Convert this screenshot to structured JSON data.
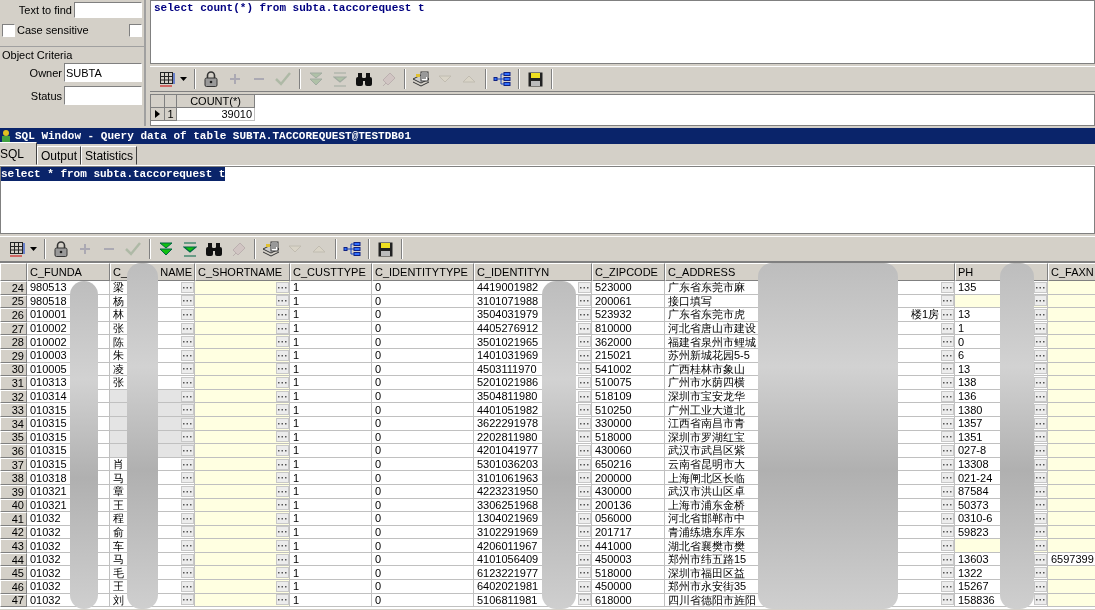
{
  "find_panel": {
    "text_to_find": {
      "label": "Text to find"
    },
    "case_sensitive": {
      "label": "Case sensitive",
      "checked": false
    },
    "extra_option": {
      "checked": false
    },
    "object_criteria": {
      "title": "Object Criteria",
      "fields": [
        {
          "label": "Owner",
          "value": "SUBTA"
        },
        {
          "label": "Status"
        }
      ]
    }
  },
  "count_editor": {
    "sql": "select count(*) from subta.taccorequest t",
    "selected": false
  },
  "count_toolbar": {
    "groups": [
      [
        {
          "kind": "grid",
          "disabled": false
        }
      ],
      [
        {
          "kind": "lock",
          "disabled": false
        },
        {
          "kind": "add",
          "disabled": true
        },
        {
          "kind": "remove",
          "disabled": true
        },
        {
          "kind": "post",
          "disabled": true
        }
      ],
      [
        {
          "kind": "fetch-next",
          "disabled": true
        },
        {
          "kind": "fetch-last",
          "disabled": true
        },
        {
          "kind": "find",
          "disabled": false
        },
        {
          "kind": "clear",
          "disabled": true
        }
      ],
      [
        {
          "kind": "export",
          "disabled": false
        },
        {
          "kind": "sort-down",
          "disabled": true
        },
        {
          "kind": "sort-up",
          "disabled": true
        }
      ],
      [
        {
          "kind": "tree",
          "disabled": false
        }
      ],
      [
        {
          "kind": "save",
          "disabled": false
        }
      ]
    ]
  },
  "count_grid": {
    "columns": [
      "COUNT(*)"
    ],
    "rows": [
      {
        "number": "1",
        "current": true,
        "cells": [
          "39010"
        ]
      }
    ]
  },
  "sql_window": {
    "title": "SQL Window - Query data of table SUBTA.TACCOREQUEST@TESTDB01",
    "tabs": [
      {
        "label": "SQL",
        "selected": true
      },
      {
        "label": "Output",
        "selected": false
      },
      {
        "label": "Statistics",
        "selected": false
      }
    ],
    "editor": {
      "sql": "select * from subta.taccorequest t",
      "selected": true
    },
    "toolbar": {
      "groups": [
        [
          {
            "kind": "grid",
            "disabled": false
          }
        ],
        [
          {
            "kind": "lock",
            "disabled": false
          },
          {
            "kind": "add",
            "disabled": true
          },
          {
            "kind": "remove",
            "disabled": true
          },
          {
            "kind": "post",
            "disabled": true
          }
        ],
        [
          {
            "kind": "fetch-next",
            "disabled": false
          },
          {
            "kind": "fetch-last",
            "disabled": false
          },
          {
            "kind": "find",
            "disabled": false
          },
          {
            "kind": "clear",
            "disabled": true
          }
        ],
        [
          {
            "kind": "export",
            "disabled": false
          },
          {
            "kind": "sort-down",
            "disabled": true
          },
          {
            "kind": "sort-up",
            "disabled": true
          }
        ],
        [
          {
            "kind": "tree",
            "disabled": false
          }
        ],
        [
          {
            "kind": "save",
            "disabled": false
          }
        ]
      ]
    },
    "grid": {
      "columns": [
        {
          "label": "C_FUNDA",
          "kind": "text"
        },
        {
          "label": "C_",
          "label_tail": "NAME",
          "kind": "lookup"
        },
        {
          "label": "C_SHORTNAME",
          "kind": "lookup"
        },
        {
          "label": "C_CUSTTYPE",
          "kind": "text"
        },
        {
          "label": "C_IDENTITYTYPE",
          "kind": "text"
        },
        {
          "label": "C_IDENTITYN",
          "kind": "lookup"
        },
        {
          "label": "C_ZIPCODE",
          "kind": "text"
        },
        {
          "label": "C_ADDRESS",
          "kind": "lookup"
        },
        {
          "label": "PH",
          "kind": "lookup"
        },
        {
          "label": "C_FAXN",
          "kind": "lookup"
        }
      ],
      "rows": [
        {
          "number": "24",
          "cells": [
            "980513",
            "梁",
            null,
            "1",
            "0",
            "4419001982",
            "523000",
            "广东省东莞市麻",
            "135",
            null
          ]
        },
        {
          "number": "25",
          "cells": [
            "980518",
            "杨",
            null,
            "1",
            "0",
            "3101071988",
            "200061",
            "接口填写",
            null,
            null
          ]
        },
        {
          "number": "26",
          "cells": [
            "010001",
            "林",
            null,
            "1",
            "0",
            "3504031979",
            "523932",
            {
              "text": "广东省东莞市虎",
              "tail": "楼1房"
            },
            "13",
            null
          ]
        },
        {
          "number": "27",
          "cells": [
            "010002",
            "张",
            null,
            "1",
            "0",
            "4405276912",
            "810000",
            "河北省唐山市建设",
            "1",
            null
          ]
        },
        {
          "number": "28",
          "cells": [
            "010002",
            "陈",
            null,
            "1",
            "0",
            "3501021965",
            "362000",
            "福建省泉州市鲤城",
            "0",
            null
          ]
        },
        {
          "number": "29",
          "cells": [
            "010003",
            "朱",
            null,
            "1",
            "0",
            "1401031969",
            "215021",
            "苏州新城花园5-5",
            "6",
            null
          ]
        },
        {
          "number": "30",
          "cells": [
            "010005",
            "凌",
            null,
            "1",
            "0",
            "4503111970",
            "541002",
            "广西桂林市象山",
            "13",
            null
          ]
        },
        {
          "number": "31",
          "cells": [
            "010313",
            "张",
            null,
            "1",
            "0",
            "5201021986",
            "510075",
            "广州市水荫四横",
            "138",
            null
          ]
        },
        {
          "number": "32",
          "cells": [
            "010314",
            {
              "redacted": true
            },
            null,
            "1",
            "0",
            "3504811980",
            "518109",
            "深圳市宝安龙华",
            "136",
            null
          ]
        },
        {
          "number": "33",
          "cells": [
            "010315",
            {
              "redacted": true
            },
            null,
            "1",
            "0",
            "4401051982",
            "510250",
            "广州工业大道北",
            "1380",
            null
          ]
        },
        {
          "number": "34",
          "cells": [
            "010315",
            {
              "redacted": true
            },
            null,
            "1",
            "0",
            "3622291978",
            "330000",
            "江西省南昌市青",
            "1357",
            null
          ]
        },
        {
          "number": "35",
          "cells": [
            "010315",
            {
              "redacted": true
            },
            null,
            "1",
            "0",
            "2202811980",
            "518000",
            "深圳市罗湖红宝",
            "1351",
            null
          ]
        },
        {
          "number": "36",
          "cells": [
            "010315",
            {
              "redacted": true
            },
            null,
            "1",
            "0",
            "4201041977",
            "430060",
            "武汉市武昌区紫",
            "027-8",
            null
          ]
        },
        {
          "number": "37",
          "cells": [
            "010315",
            "肖",
            null,
            "1",
            "0",
            "5301036203",
            "650216",
            "云南省昆明市大",
            "13308",
            null
          ]
        },
        {
          "number": "38",
          "cells": [
            "010318",
            "马",
            null,
            "1",
            "0",
            "3101061963",
            "200000",
            "上海闸北区长临",
            "021-24",
            null
          ]
        },
        {
          "number": "39",
          "cells": [
            "010321",
            "章",
            null,
            "1",
            "0",
            "4223231950",
            "430000",
            "武汉市洪山区卓",
            "87584",
            null
          ]
        },
        {
          "number": "40",
          "cells": [
            "010321",
            "王",
            null,
            "1",
            "0",
            "3306251968",
            "200136",
            "上海市浦东金桥",
            "50373",
            null
          ]
        },
        {
          "number": "41",
          "cells": [
            "01032",
            "程",
            null,
            "1",
            "0",
            "1304021969",
            "056000",
            "河北省邯郸市中",
            "0310-6",
            null
          ]
        },
        {
          "number": "42",
          "cells": [
            "01032",
            "俞",
            null,
            "1",
            "0",
            "3102291969",
            "201717",
            "青浦练塘东库东",
            "59823",
            null
          ]
        },
        {
          "number": "43",
          "cells": [
            "01032",
            "车",
            null,
            "1",
            "0",
            "4206011967",
            "441000",
            "湖北省襄樊市樊",
            null,
            null
          ]
        },
        {
          "number": "44",
          "cells": [
            "01032",
            "马",
            null,
            "1",
            "0",
            "4101056409",
            "450003",
            "郑州市纬五路15",
            "13603",
            "6597399"
          ]
        },
        {
          "number": "45",
          "cells": [
            "01032",
            "毛",
            null,
            "1",
            "0",
            "6123221977",
            "518000",
            "深圳市福田区益",
            "1322",
            null
          ]
        },
        {
          "number": "46",
          "cells": [
            "01032",
            "王",
            null,
            "1",
            "0",
            "6402021981",
            "450000",
            "郑州市永安街35",
            "15267",
            null
          ]
        },
        {
          "number": "47",
          "cells": [
            "01032",
            "刘",
            null,
            "1",
            "0",
            "5106811981",
            "618000",
            "四川省德阳市旌阳",
            "158836",
            null
          ]
        }
      ]
    }
  }
}
